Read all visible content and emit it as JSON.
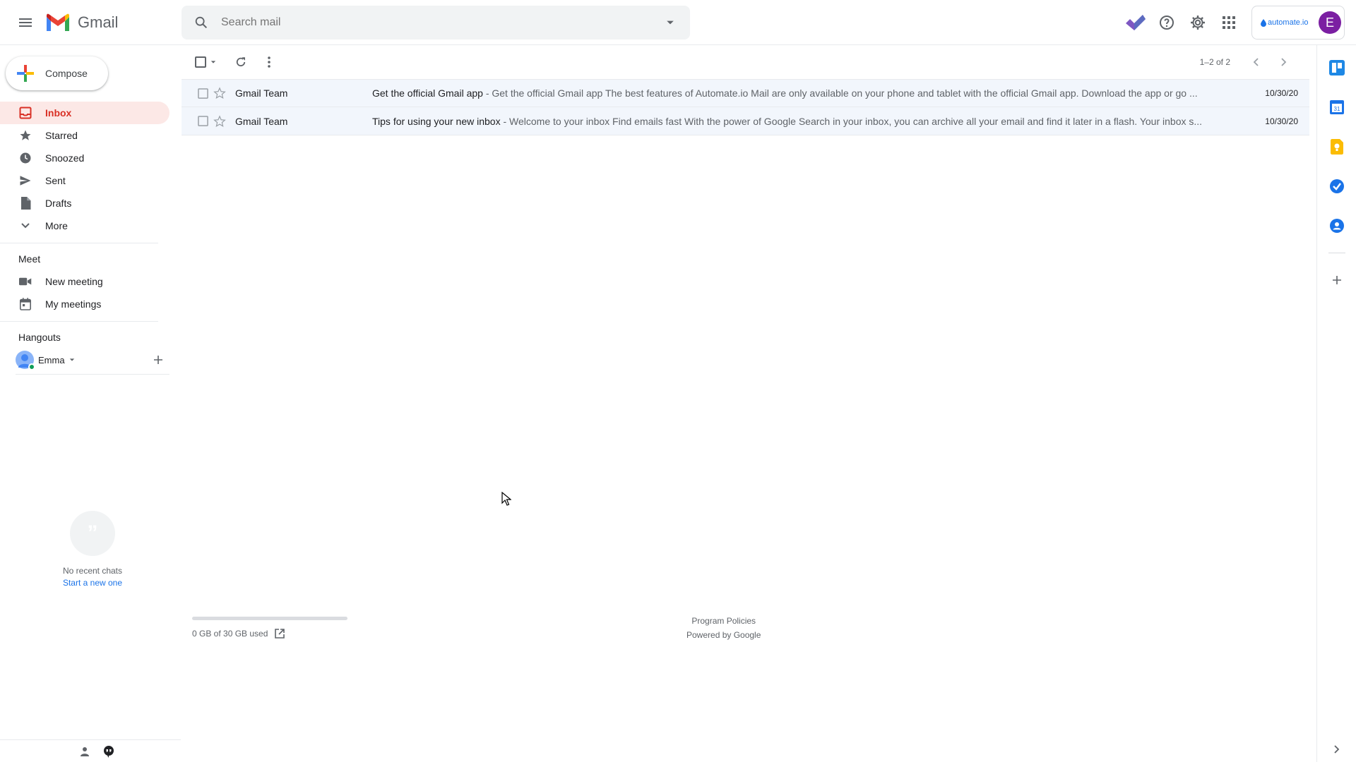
{
  "app": {
    "name": "Gmail"
  },
  "search": {
    "placeholder": "Search mail"
  },
  "topbar": {
    "icons": [
      "menu-icon",
      "search-icon",
      "dropdown-caret-icon",
      "checkmark-extension-icon",
      "help-icon",
      "settings-icon",
      "apps-grid-icon"
    ],
    "account_brand": "automate.io",
    "avatar_letter": "E"
  },
  "sidebar": {
    "compose_label": "Compose",
    "items": [
      {
        "label": "Inbox",
        "icon": "inbox-icon",
        "active": true
      },
      {
        "label": "Starred",
        "icon": "star-icon"
      },
      {
        "label": "Snoozed",
        "icon": "clock-icon"
      },
      {
        "label": "Sent",
        "icon": "send-icon"
      },
      {
        "label": "Drafts",
        "icon": "draft-icon"
      },
      {
        "label": "More",
        "icon": "chevron-down-icon"
      }
    ],
    "meet": {
      "title": "Meet",
      "items": [
        {
          "label": "New meeting",
          "icon": "video-icon"
        },
        {
          "label": "My meetings",
          "icon": "calendar-icon"
        }
      ]
    },
    "hangouts": {
      "title": "Hangouts",
      "user": "Emma",
      "no_chats": "No recent chats",
      "start_new": "Start a new one"
    }
  },
  "toolbar": {
    "pager_text": "1–2 of 2"
  },
  "emails": [
    {
      "sender": "Gmail Team",
      "subject": "Get the official Gmail app",
      "snippet": " - Get the official Gmail app The best features of Automate.io Mail are only available on your phone and tablet with the official Gmail app. Download the app or go ...",
      "date": "10/30/20"
    },
    {
      "sender": "Gmail Team",
      "subject": "Tips for using your new inbox",
      "snippet": " - Welcome to your inbox Find emails fast With the power of Google Search in your inbox, you can archive all your email and find it later in a flash. Your inbox s...",
      "date": "10/30/20"
    }
  ],
  "footer": {
    "storage": "0 GB of 30 GB used",
    "storage_fraction": 0,
    "program_policies": "Program Policies",
    "powered_by": "Powered by Google"
  },
  "colors": {
    "active_bg": "#fce8e6",
    "active_text": "#d93025",
    "link": "#1a73e8",
    "avatar": "#7b1fa2"
  }
}
